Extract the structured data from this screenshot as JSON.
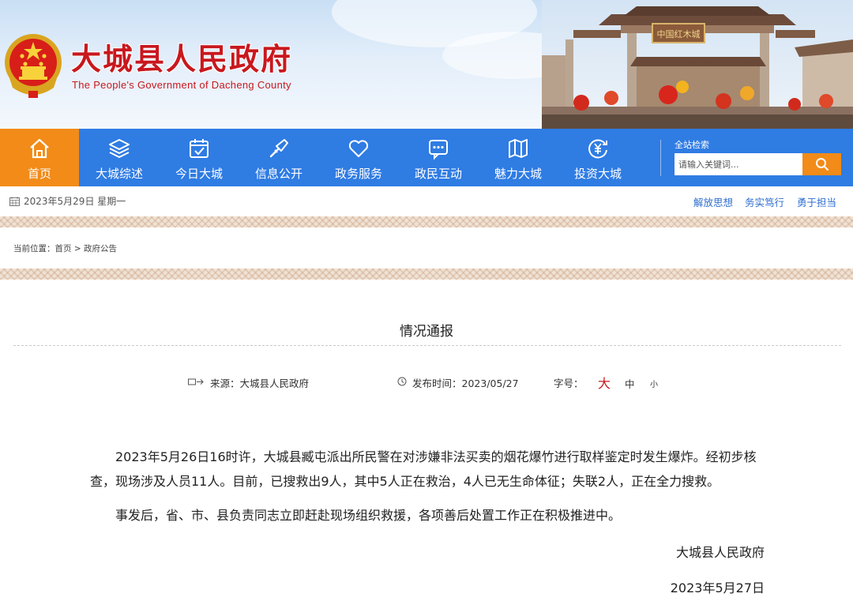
{
  "header": {
    "title": "大城县人民政府",
    "subtitle": "The People's Government of Dacheng County",
    "gate_plaque": "中国红木城"
  },
  "nav": {
    "items": [
      {
        "label": "首页",
        "icon": "home-icon"
      },
      {
        "label": "大城综述",
        "icon": "layers-icon"
      },
      {
        "label": "今日大城",
        "icon": "calendar-icon"
      },
      {
        "label": "信息公开",
        "icon": "megaphone-icon"
      },
      {
        "label": "政务服务",
        "icon": "heart-icon"
      },
      {
        "label": "政民互动",
        "icon": "chat-icon"
      },
      {
        "label": "魅力大城",
        "icon": "map-icon"
      },
      {
        "label": "投资大城",
        "icon": "yuan-icon"
      }
    ],
    "active_color": "#f28b18",
    "bar_color": "#2f7ce3"
  },
  "search": {
    "title": "全站检索",
    "placeholder": "请输入关键词..."
  },
  "infobar": {
    "date": "2023年5月29日 星期一",
    "slogans": [
      "解放思想",
      "务实笃行",
      "勇于担当"
    ]
  },
  "breadcrumb": {
    "prefix": "当前位置：",
    "home": "首页",
    "sep": " > ",
    "current": "政府公告"
  },
  "article": {
    "title": "情况通报",
    "source_label": "来源：",
    "source": "大城县人民政府",
    "time_label": "发布时间：",
    "time": "2023/05/27",
    "fontsize_label": "字号：",
    "fontsize_large": "大",
    "fontsize_medium": "中",
    "fontsize_small": "小",
    "paragraphs": [
      "2023年5月26日16时许，大城县臧屯派出所民警在对涉嫌非法买卖的烟花爆竹进行取样鉴定时发生爆炸。经初步核查，现场涉及人员11人。目前，已搜救出9人，其中5人正在救治，4人已无生命体征；失联2人，正在全力搜救。",
      "事发后，省、市、县负责同志立即赶赴现场组织救援，各项善后处置工作正在积极推进中。"
    ],
    "signature": "大城县人民政府",
    "sign_date": "2023年5月27日"
  }
}
